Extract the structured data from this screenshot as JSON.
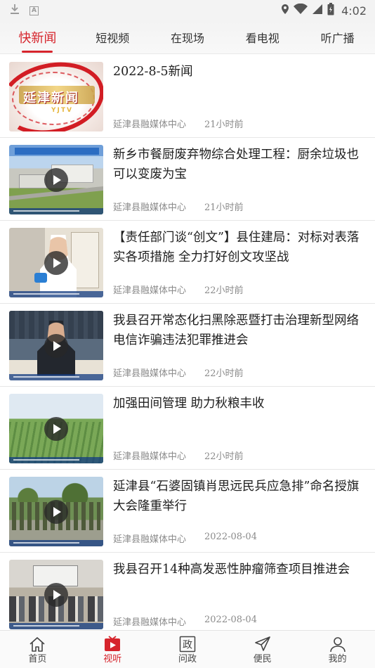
{
  "status_bar": {
    "time": "4:02",
    "left_icons": [
      "download-icon",
      "a-letter-icon"
    ],
    "right_icons": [
      "location-icon",
      "wifi-icon",
      "signal-icon",
      "battery-icon"
    ]
  },
  "tabs": [
    {
      "label": "快新闻",
      "active": true
    },
    {
      "label": "短视频",
      "active": false
    },
    {
      "label": "在现场",
      "active": false
    },
    {
      "label": "看电视",
      "active": false
    },
    {
      "label": "听广播",
      "active": false
    }
  ],
  "news": [
    {
      "title": "2022-8-5新闻",
      "source": "延津县融媒体中心",
      "time": "21小时前",
      "video": false,
      "thumb_text": "延津新闻",
      "thumb_sub": "YJTV"
    },
    {
      "title": "新乡市餐厨废弃物综合处理工程：厨余垃圾也可以变废为宝",
      "source": "延津县融媒体中心",
      "time": "21小时前",
      "video": true
    },
    {
      "title": "【责任部门谈“创文”】县住建局：对标对表落实各项措施 全力打好创文攻坚战",
      "source": "延津县融媒体中心",
      "time": "22小时前",
      "video": true
    },
    {
      "title": "我县召开常态化扫黑除恶暨打击治理新型网络电信诈骗违法犯罪推进会",
      "source": "延津县融媒体中心",
      "time": "22小时前",
      "video": true
    },
    {
      "title": "加强田间管理 助力秋粮丰收",
      "source": "延津县融媒体中心",
      "time": "22小时前",
      "video": true
    },
    {
      "title": "延津县“石婆固镇肖思远民兵应急排”命名授旗大会隆重举行",
      "source": "延津县融媒体中心",
      "time": "2022-08-04",
      "video": true
    },
    {
      "title": "我县召开14种高发恶性肿瘤筛查项目推进会",
      "source": "延津县融媒体中心",
      "time": "2022-08-04",
      "video": true
    }
  ],
  "bottom_nav": [
    {
      "label": "首页",
      "icon": "home-icon",
      "active": false
    },
    {
      "label": "视听",
      "icon": "video-play-icon",
      "active": true
    },
    {
      "label": "问政",
      "icon": "politics-icon",
      "active": false
    },
    {
      "label": "便民",
      "icon": "send-icon",
      "active": false
    },
    {
      "label": "我的",
      "icon": "user-icon",
      "active": false
    }
  ],
  "colors": {
    "accent": "#d6242c",
    "meta_text": "#8a8a8a",
    "background": "#ffffff"
  }
}
